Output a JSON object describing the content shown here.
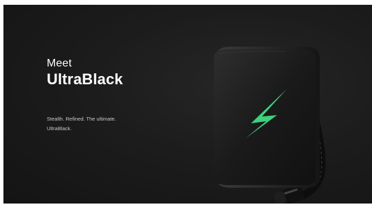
{
  "hero": {
    "eyebrow": "Meet",
    "title": "UltraBlack",
    "tagline_line1": "Stealth. Refined. The ultimate.",
    "tagline_line2": "UltraBlack.",
    "background_color": "#1c1c1c",
    "accent_color": "#3fd07d"
  },
  "product_image": {
    "icon": "lightning-bolt-icon"
  }
}
